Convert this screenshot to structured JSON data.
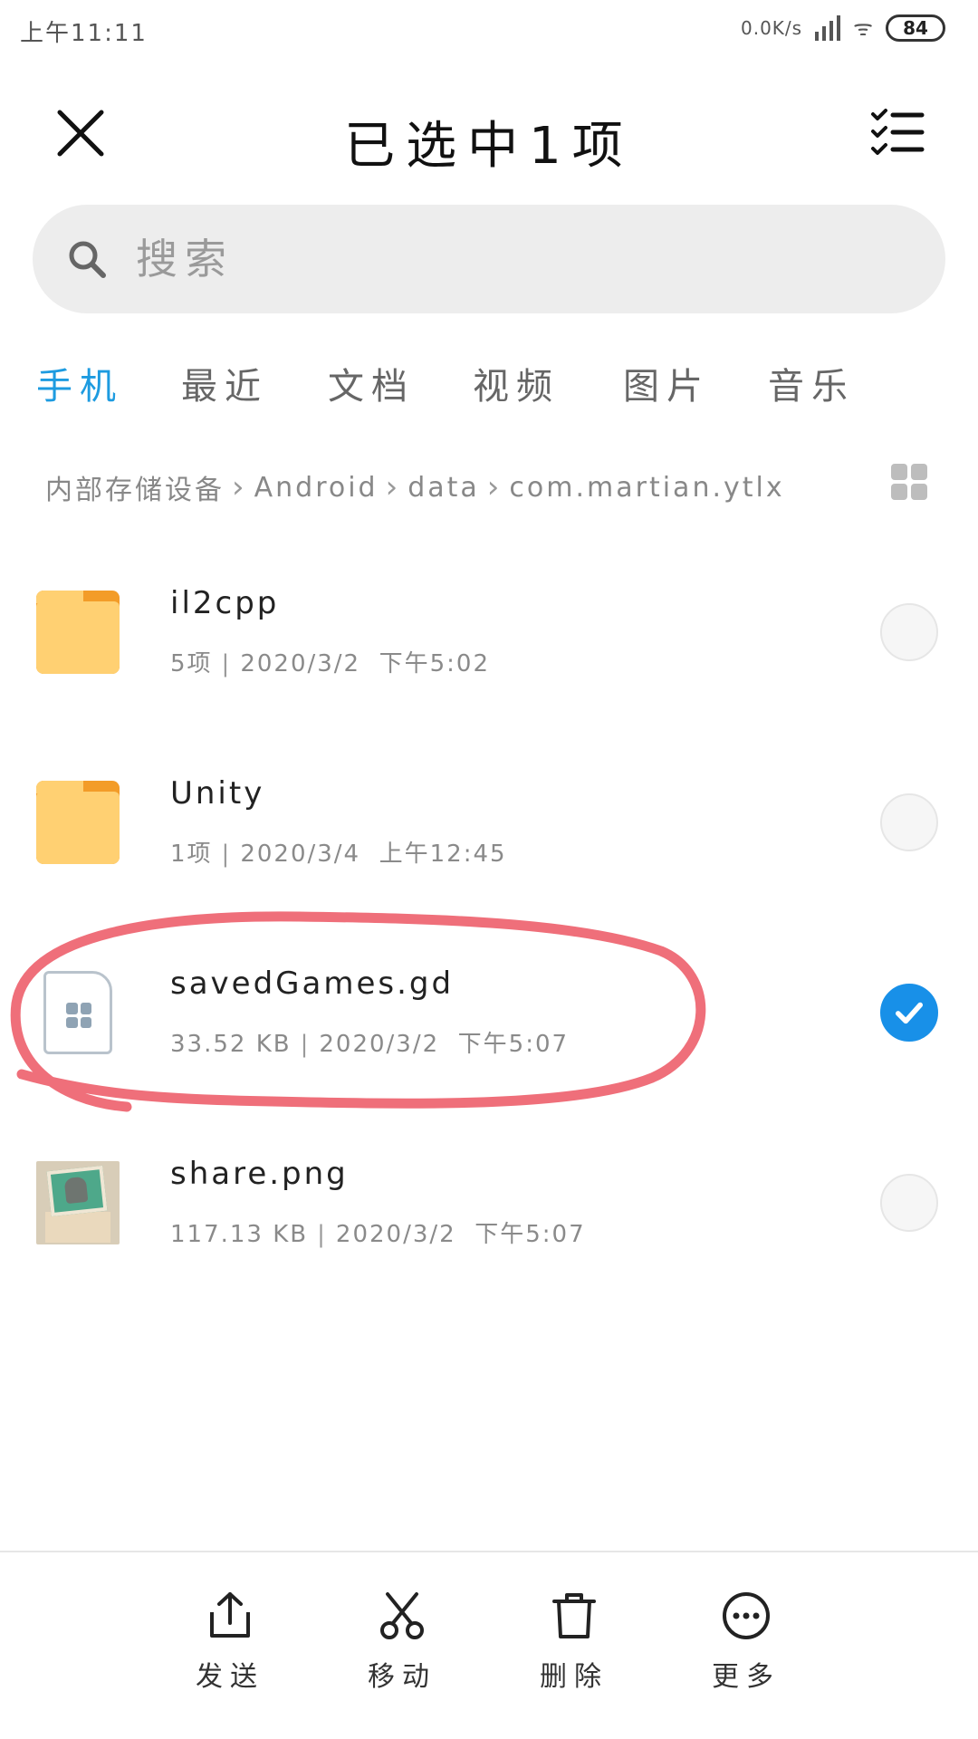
{
  "status_bar": {
    "time": "上午11:11",
    "net_speed": "0.0K/s",
    "battery": "84"
  },
  "header": {
    "title": "已选中1项"
  },
  "search": {
    "placeholder": "搜索"
  },
  "tabs": [
    {
      "label": "手机",
      "active": true
    },
    {
      "label": "最近"
    },
    {
      "label": "文档"
    },
    {
      "label": "视频"
    },
    {
      "label": "图片"
    },
    {
      "label": "音乐"
    }
  ],
  "breadcrumb": [
    "内部存储设备",
    "Android",
    "data",
    "com.martian.ytlx"
  ],
  "files": [
    {
      "name": "il2cpp",
      "size": "5项",
      "date": "2020/3/2",
      "time": "下午5:02",
      "icon": "folder-icon",
      "checked": false
    },
    {
      "name": "Unity",
      "size": "1项",
      "date": "2020/3/4",
      "time": "上午12:45",
      "icon": "folder-icon",
      "checked": false
    },
    {
      "name": "savedGames.gd",
      "size": "33.52 KB",
      "date": "2020/3/2",
      "time": "下午5:07",
      "icon": "document-icon",
      "checked": true
    },
    {
      "name": "share.png",
      "size": "117.13 KB",
      "date": "2020/3/2",
      "time": "下午5:07",
      "icon": "image-thumbnail-icon",
      "checked": false
    }
  ],
  "bottom_actions": [
    {
      "label": "发送",
      "icon": "share-icon"
    },
    {
      "label": "移动",
      "icon": "scissors-icon"
    },
    {
      "label": "删除",
      "icon": "trash-icon"
    },
    {
      "label": "更多",
      "icon": "more-icon"
    }
  ],
  "colors": {
    "accent": "#1d9be0",
    "checked": "#1890e8",
    "annotation": "#ef6f7a",
    "folder_front": "#ffd072",
    "folder_back": "#f39c28"
  }
}
